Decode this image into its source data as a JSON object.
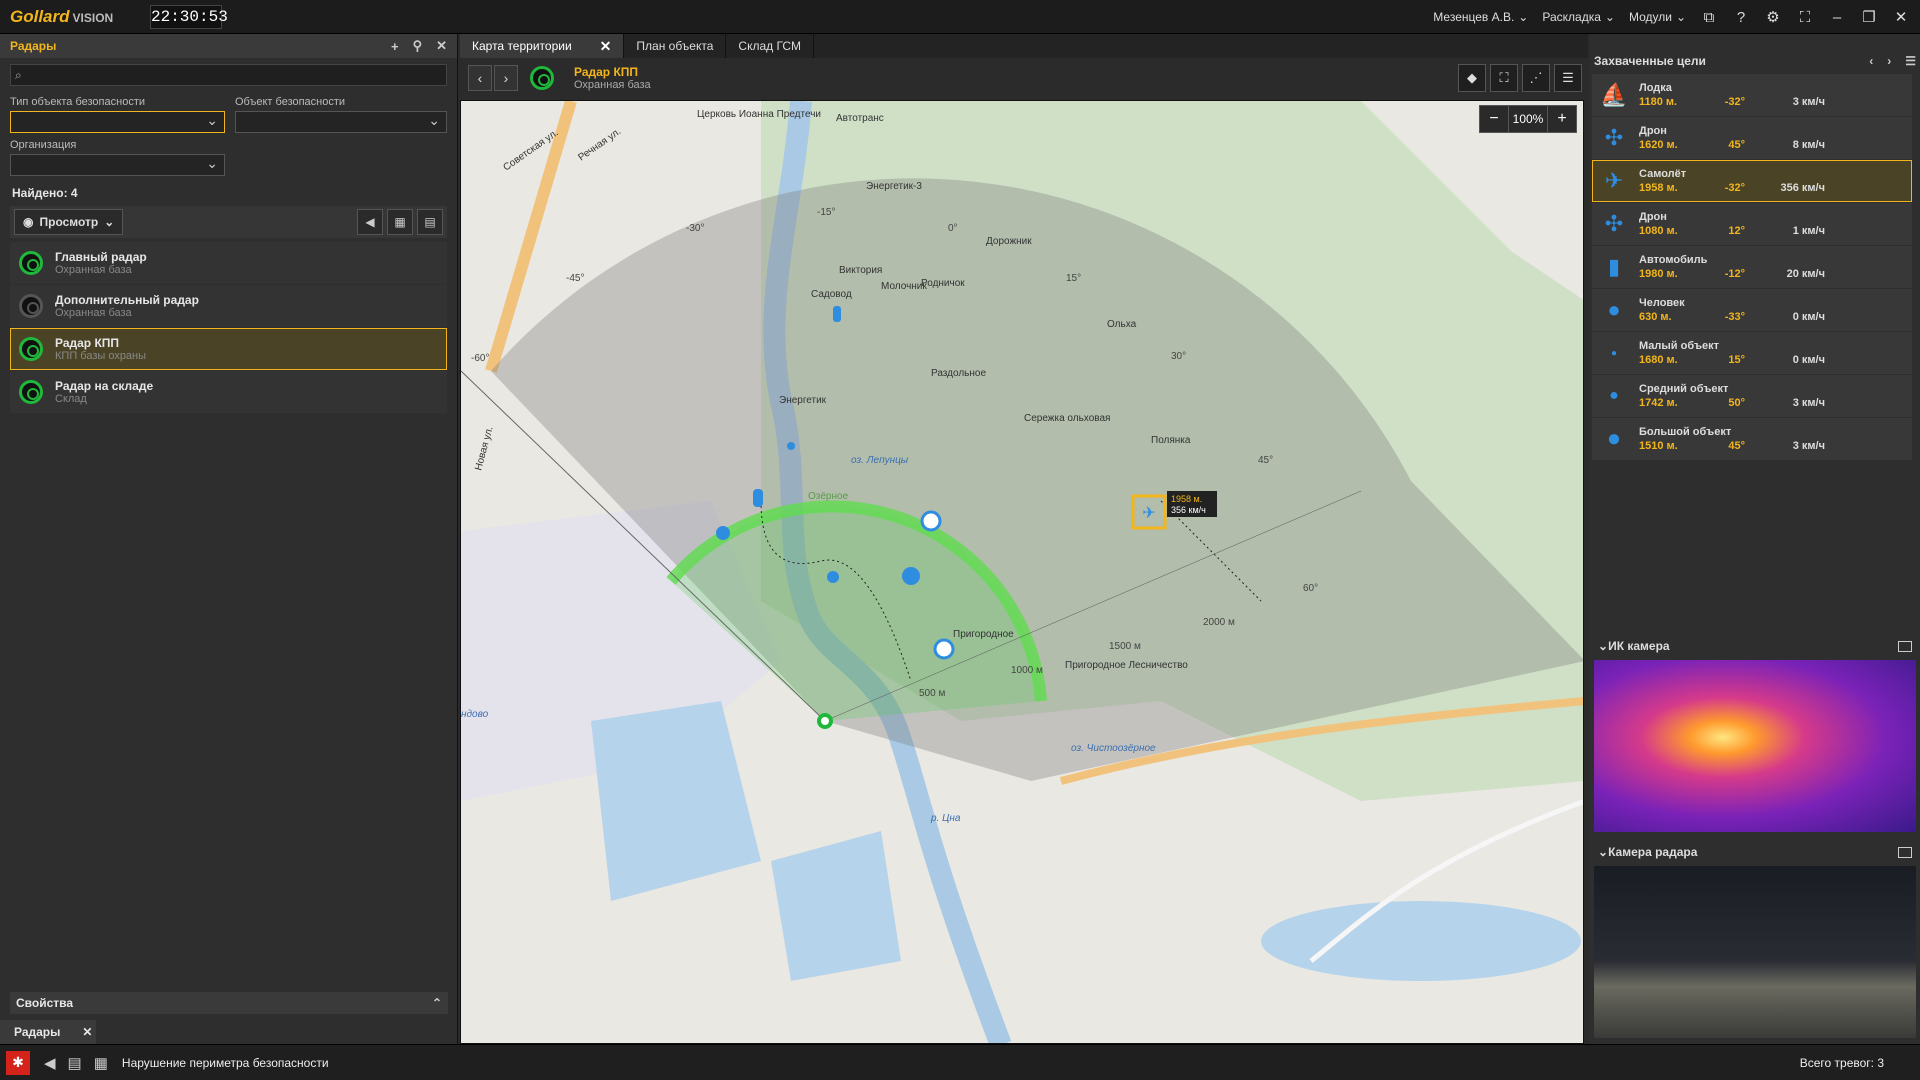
{
  "app": {
    "brand": "Gollard",
    "brand_sub": "VISION",
    "clock": "22:30:53",
    "user": "Мезенцев А.В.",
    "layout_menu": "Раскладка",
    "modules_menu": "Модули",
    "accent": "#f2b51c"
  },
  "left": {
    "title": "Радары",
    "filter_type_label": "Тип объекта безопасности",
    "filter_object_label": "Объект безопасности",
    "filter_org_label": "Организация",
    "found": "Найдено: 4",
    "view_button": "Просмотр",
    "radars": [
      {
        "name": "Главный радар",
        "sub": "Охранная база"
      },
      {
        "name": "Дополнительный радар",
        "sub": "Охранная база"
      },
      {
        "name": "Радар КПП",
        "sub": "КПП базы охраны"
      },
      {
        "name": "Радар на складе",
        "sub": "Склад"
      }
    ],
    "properties": "Свойства",
    "bottom_tab": "Радары"
  },
  "center": {
    "tabs": [
      "Карта территории",
      "План объекта",
      "Склад ГСМ"
    ],
    "radar_title": "Радар КПП",
    "radar_sub": "Охранная база",
    "zoom": "100%",
    "map_labels": [
      "Советская ул.",
      "Речная ул.",
      "Церковь Иоанна Предтечи",
      "Автотранс",
      "Энергетик-3",
      "Дорожник",
      "Виктория",
      "Садовод",
      "Молочник",
      "Родничок",
      "Ольха",
      "Раздольное",
      "Энергетик",
      "Сережка ольховая",
      "Полянка",
      "оз. Лепунцы",
      "Озёрное",
      "Пригородное",
      "Пригородное Лесничество",
      "оз. Чистоозёрное",
      "р. Цна",
      "Новая ул.",
      "ндово"
    ],
    "angles": [
      "-15°",
      "0°",
      "-30°",
      "-45°",
      "15°",
      "-60°",
      "30°",
      "45°",
      "60°"
    ],
    "ranges": [
      "500 м",
      "1000 м",
      "1500 м",
      "2000 м"
    ],
    "tooltip_dist": "1958 м.",
    "tooltip_speed": "356 км/ч"
  },
  "right": {
    "title": "Захваченные цели",
    "targets": [
      {
        "name": "Лодка",
        "dist": "1180 м.",
        "angle": "-32°",
        "speed": "3 км/ч",
        "icon": "boat-icon"
      },
      {
        "name": "Дрон",
        "dist": "1620 м.",
        "angle": "45°",
        "speed": "8 км/ч",
        "icon": "drone-icon"
      },
      {
        "name": "Самолёт",
        "dist": "1958 м.",
        "angle": "-32°",
        "speed": "356 км/ч",
        "icon": "plane-icon"
      },
      {
        "name": "Дрон",
        "dist": "1080 м.",
        "angle": "12°",
        "speed": "1 км/ч",
        "icon": "drone-icon"
      },
      {
        "name": "Автомобиль",
        "dist": "1980 м.",
        "angle": "-12°",
        "speed": "20 км/ч",
        "icon": "car-icon"
      },
      {
        "name": "Человек",
        "dist": "630 м.",
        "angle": "-33°",
        "speed": "0 км/ч",
        "icon": "person-icon"
      },
      {
        "name": "Малый объект",
        "dist": "1680 м.",
        "angle": "15°",
        "speed": "0 км/ч",
        "icon": "small-object-icon"
      },
      {
        "name": "Средний объект",
        "dist": "1742 м.",
        "angle": "50°",
        "speed": "3 км/ч",
        "icon": "medium-object-icon"
      },
      {
        "name": "Большой объект",
        "dist": "1510 м.",
        "angle": "45°",
        "speed": "3 км/ч",
        "icon": "large-object-icon"
      }
    ],
    "ir_camera": "ИК камера",
    "radar_camera": "Камера радара"
  },
  "status": {
    "message": "Нарушение периметра безопасности",
    "total": "Всего тревог: 3"
  }
}
